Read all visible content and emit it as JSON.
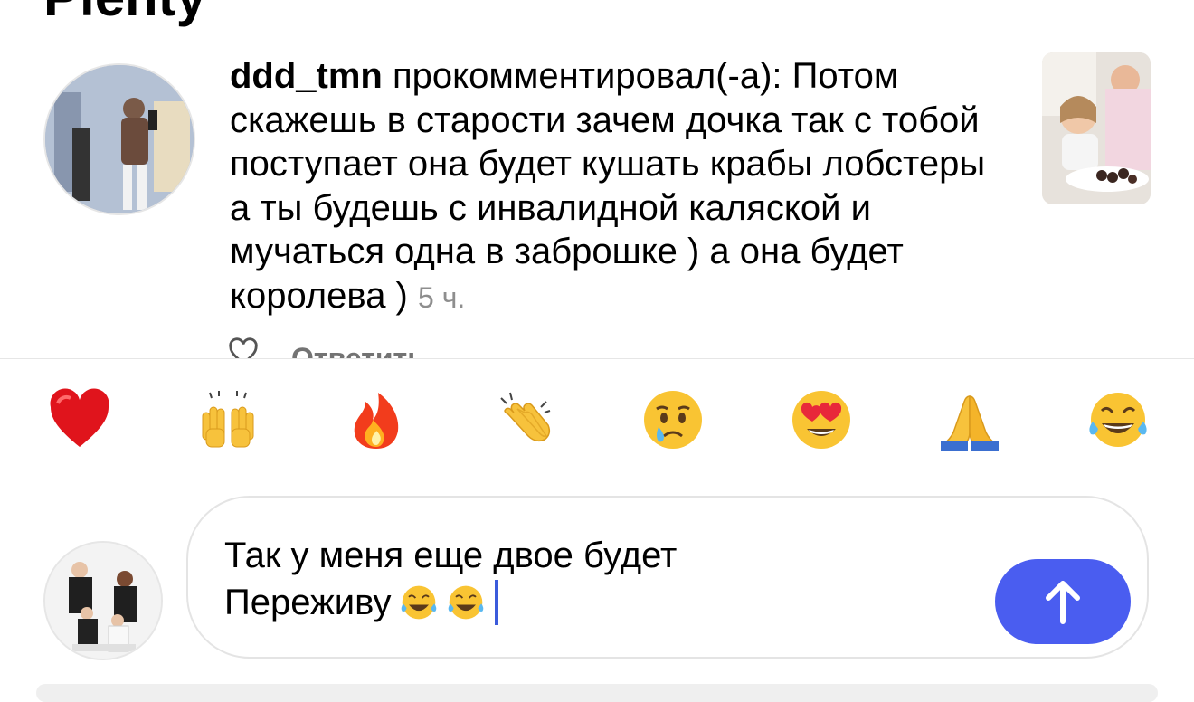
{
  "header": {
    "title": "Plenty"
  },
  "notification": {
    "username": "ddd_tmn",
    "body": " прокомментировал(-а): Потом скажешь в старости зачем дочка так с тобой поступает она будет кушать крабы лобстеры а ты будешь с инвалидной каляской и мучаться одна в заброшке ) а она будет королева )",
    "time": "5 ч.",
    "reply_label": "Ответить"
  },
  "reactions": [
    {
      "name": "heart",
      "icon": "heart-emoji"
    },
    {
      "name": "raising-hands",
      "icon": "raising-hands-emoji"
    },
    {
      "name": "fire",
      "icon": "fire-emoji"
    },
    {
      "name": "clapping",
      "icon": "clapping-hands-emoji"
    },
    {
      "name": "crying",
      "icon": "crying-face-emoji"
    },
    {
      "name": "heart-eyes",
      "icon": "heart-eyes-emoji"
    },
    {
      "name": "folded-hands",
      "icon": "folded-hands-emoji"
    },
    {
      "name": "tears-of-joy",
      "icon": "tears-of-joy-emoji"
    }
  ],
  "composer": {
    "line1": "Так у меня еще двое будет",
    "line2": "Переживу",
    "trailing_emoji": "tears-of-joy-emoji x2",
    "send_icon": "arrow-up-icon",
    "accent_color": "#4a5df0"
  }
}
